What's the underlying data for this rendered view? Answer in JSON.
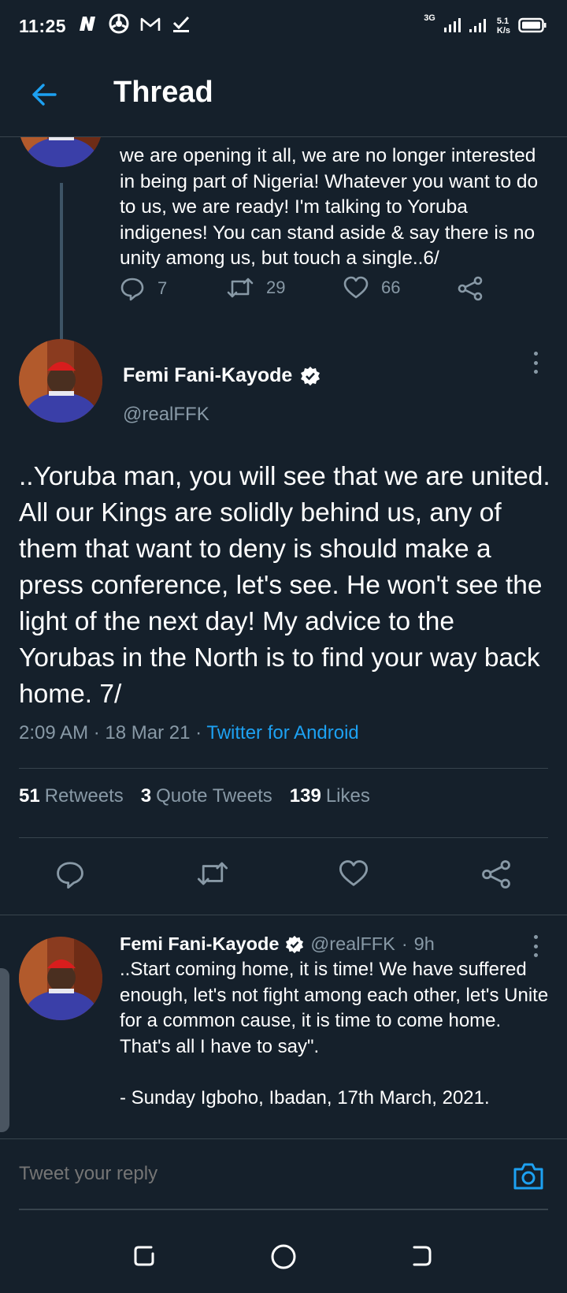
{
  "status_bar": {
    "time": "11:25",
    "network_type": "3G",
    "speed_value": "5.1",
    "speed_unit": "K/s"
  },
  "header": {
    "title": "Thread",
    "back_icon": "arrow-left-icon"
  },
  "previous_tweet": {
    "text": "we are opening it all, we are no longer interested in being part of Nigeria! Whatever you want to do to us, we are ready! I'm talking to Yoruba indigenes! You can stand aside & say there is no unity among us, but touch a single..6/",
    "replies": "7",
    "retweets": "29",
    "likes": "66"
  },
  "main_tweet": {
    "name": "Femi Fani-Kayode",
    "handle": "@realFFK",
    "text": "..Yoruba man, you will see that we are united. All our Kings are solidly behind us, any of them that want to deny is should make a press conference, let's see. He won't see the light of the next day! My advice to the Yorubas in the North is to find your way back home. 7/",
    "time": "2:09 AM",
    "date": "18 Mar 21",
    "source": "Twitter for Android",
    "retweets_count": "51",
    "retweets_label": "Retweets",
    "quotes_count": "3",
    "quotes_label": "Quote Tweets",
    "likes_count": "139",
    "likes_label": "Likes"
  },
  "reply_tweet": {
    "name": "Femi Fani-Kayode",
    "handle": "@realFFK",
    "age": "9h",
    "text": "..Start coming home, it is time! We have suffered enough, let's not fight among each other, let's Unite for a common cause, it is time to come home. That's all I have to say\".\n\n- Sunday Igboho, Ibadan, 17th March, 2021."
  },
  "reply_bar": {
    "placeholder": "Tweet your reply"
  },
  "colors": {
    "background": "#15202b",
    "accent": "#1da1f2",
    "muted": "#8899a6",
    "divider": "#38444d"
  }
}
